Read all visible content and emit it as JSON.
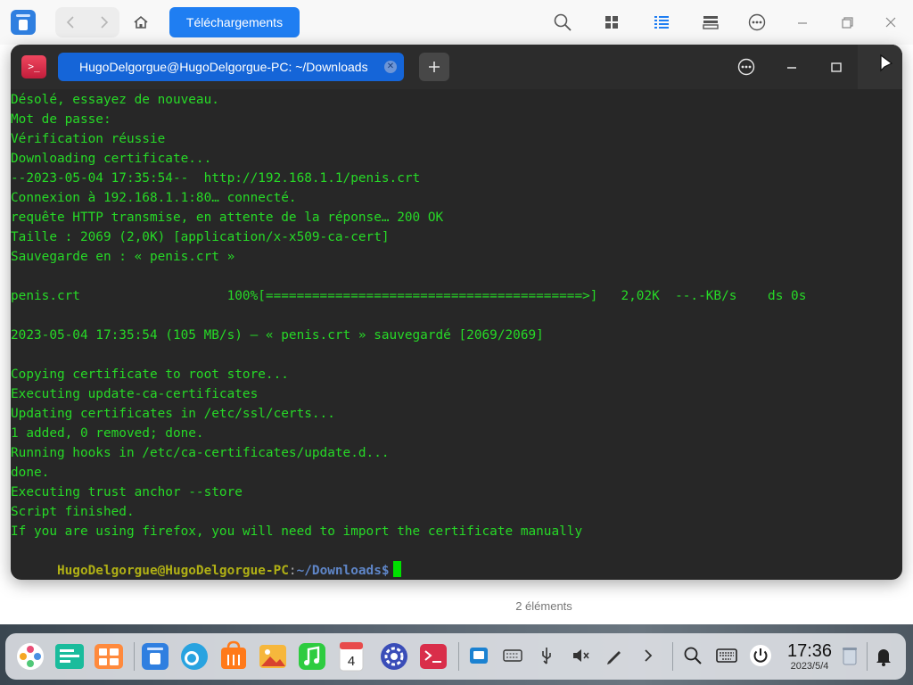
{
  "file_manager": {
    "breadcrumb": "Téléchargements",
    "status": "2 éléments"
  },
  "terminal": {
    "tab_title": "HugoDelgorgue@HugoDelgorgue-PC: ~/Downloads",
    "output_lines": [
      "Désolé, essayez de nouveau.",
      "Mot de passe:",
      "Vérification réussie",
      "Downloading certificate...",
      "--2023-05-04 17:35:54--  http://192.168.1.1/penis.crt",
      "Connexion à 192.168.1.1:80… connecté.",
      "requête HTTP transmise, en attente de la réponse… 200 OK",
      "Taille : 2069 (2,0K) [application/x-x509-ca-cert]",
      "Sauvegarde en : « penis.crt »",
      "",
      "penis.crt                   100%[=========================================>]   2,02K  --.-KB/s    ds 0s",
      "",
      "2023-05-04 17:35:54 (105 MB/s) — « penis.crt » sauvegardé [2069/2069]",
      "",
      "Copying certificate to root store...",
      "Executing update-ca-certificates",
      "Updating certificates in /etc/ssl/certs...",
      "1 added, 0 removed; done.",
      "Running hooks in /etc/ca-certificates/update.d...",
      "done.",
      "Executing trust anchor --store",
      "Script finished.",
      "If you are using firefox, you will need to import the certificate manually"
    ],
    "prompt": {
      "user_host": "HugoDelgorgue@HugoDelgorgue-PC",
      "colon": ":",
      "path": "~/Downloads",
      "symbol": "$"
    }
  },
  "taskbar": {
    "time": "17:36",
    "date": "2023/5/4",
    "calendar_day": "4",
    "apps": [
      "launcher",
      "multitasking-view",
      "workspace",
      "file-manager",
      "browser",
      "app-store",
      "image-viewer",
      "music",
      "calendar",
      "control-center",
      "terminal"
    ],
    "tray": [
      "screenshot",
      "keyboard",
      "usb",
      "volume-muted",
      "pen",
      "expand",
      "search",
      "onscreen-keyboard",
      "power",
      "trash",
      "notifications"
    ]
  },
  "colors": {
    "accent": "#1f7ef2",
    "terminal_bg": "#272727",
    "terminal_text": "#27d927",
    "prompt_user": "#b0b015",
    "prompt_path": "#5f86c8"
  }
}
